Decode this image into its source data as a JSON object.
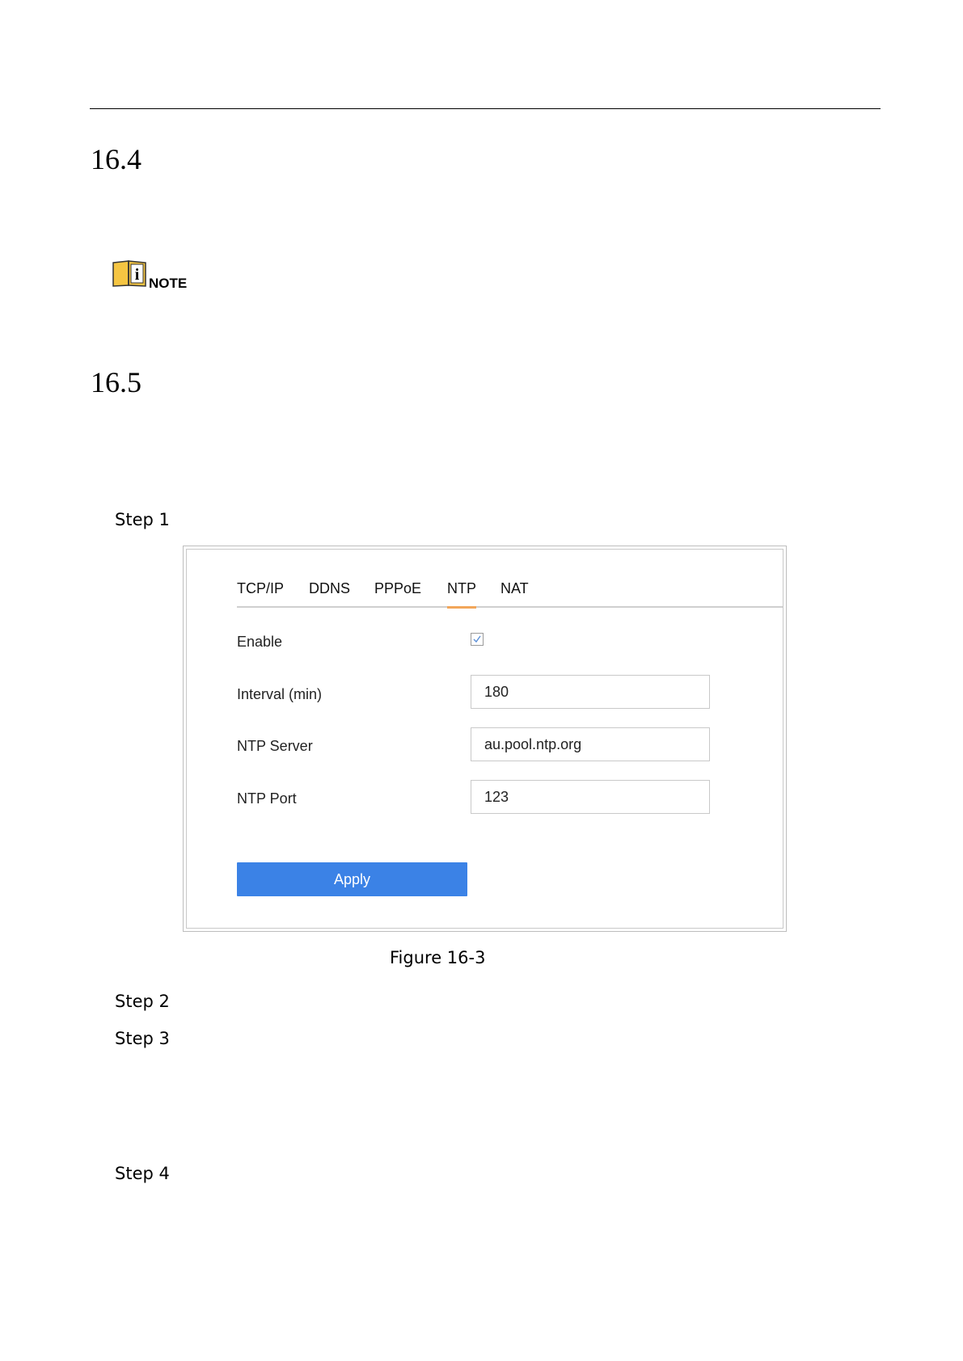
{
  "sections": [
    {
      "number": "16.4"
    },
    {
      "number": "16.5"
    }
  ],
  "note": {
    "label": "NOTE",
    "icon": "info-book-icon"
  },
  "steps": [
    "Step 1",
    "Step 2",
    "Step 3",
    "Step 4"
  ],
  "figure": {
    "caption": "Figure 16-3",
    "tabs": [
      {
        "label": "TCP/IP"
      },
      {
        "label": "DDNS"
      },
      {
        "label": "PPPoE"
      },
      {
        "label": "NTP",
        "active": true
      },
      {
        "label": "NAT"
      }
    ],
    "fields": {
      "enable": {
        "label": "Enable",
        "checked": true
      },
      "interval": {
        "label": "Interval (min)",
        "value": "180"
      },
      "ntp_server": {
        "label": "NTP Server",
        "value": "au.pool.ntp.org"
      },
      "ntp_port": {
        "label": "NTP Port",
        "value": "123"
      }
    },
    "apply_label": "Apply",
    "colors": {
      "accent": "#3b82e6",
      "active_tab_underline": "#f2a65a",
      "note_icon": "#f5c542"
    }
  }
}
